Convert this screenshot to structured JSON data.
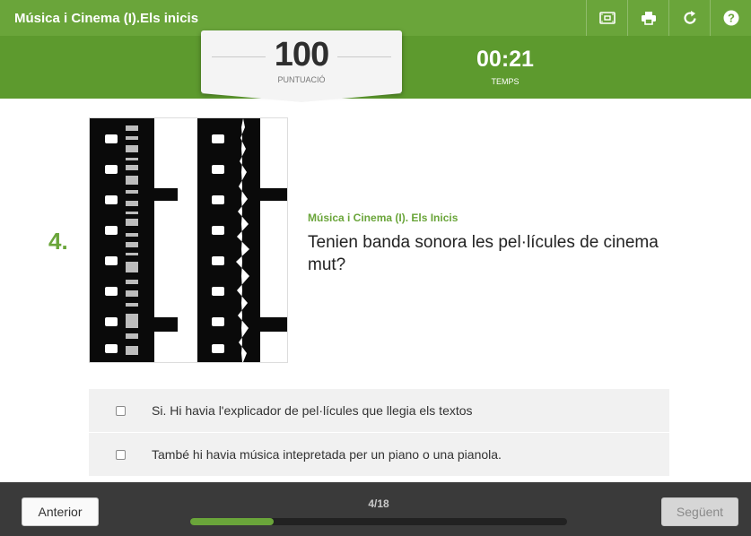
{
  "header": {
    "title": "Música i Cinema (I).Els inicis",
    "buttons": [
      {
        "icon": "fullscreen-icon"
      },
      {
        "icon": "print-icon"
      },
      {
        "icon": "restart-icon"
      },
      {
        "icon": "help-icon"
      }
    ]
  },
  "score": {
    "value": "100",
    "label": "PUNTUACIÓ"
  },
  "timer": {
    "value": "00:21",
    "label": "TEMPS"
  },
  "question": {
    "number": "4.",
    "category": "Música i Cinema (I). Els Inicis",
    "text": "Tenien banda sonora les pel·lícules de cinema mut?",
    "image_icon": "film-soundtrack-strip-image"
  },
  "answers": [
    {
      "text": "Si. Hi havia l'explicador de pel·lícules que llegia els textos",
      "checked": false
    },
    {
      "text": "També hi havia música intepretada per un piano o una pianola.",
      "checked": false
    }
  ],
  "footer": {
    "prev_label": "Anterior",
    "next_label": "Següent",
    "progress_label": "4/18",
    "progress_current": 4,
    "progress_total": 18
  },
  "colors": {
    "brand_green": "#6aa53a",
    "score_band": "#5d9a2e",
    "footer": "#3a3a3a"
  }
}
